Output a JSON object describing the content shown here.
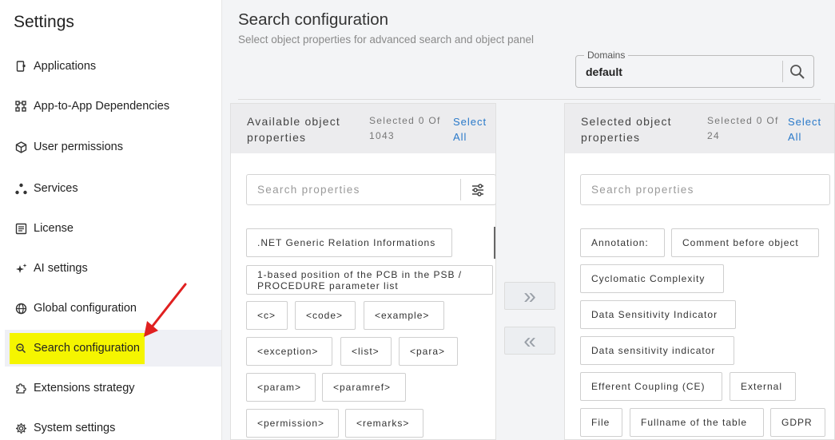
{
  "sidebar": {
    "title": "Settings",
    "items": [
      {
        "label": "Applications",
        "icon": "app-icon"
      },
      {
        "label": "App-to-App Dependencies",
        "icon": "dependencies-icon"
      },
      {
        "label": "User permissions",
        "icon": "cube-icon"
      },
      {
        "label": "Services",
        "icon": "services-icon"
      },
      {
        "label": "License",
        "icon": "license-icon"
      },
      {
        "label": "AI settings",
        "icon": "sparkle-icon"
      },
      {
        "label": "Global configuration",
        "icon": "globe-icon"
      },
      {
        "label": "Search configuration",
        "icon": "search-config-icon",
        "active": true,
        "highlight": "#f5f500"
      },
      {
        "label": "Extensions strategy",
        "icon": "puzzle-icon"
      },
      {
        "label": "System settings",
        "icon": "gear-icon"
      }
    ]
  },
  "main": {
    "title": "Search configuration",
    "subtitle": "Select object properties for advanced search and object panel",
    "domains": {
      "label": "Domains",
      "value": "default"
    }
  },
  "available": {
    "title": "Available object properties",
    "count": "Selected 0 Of 1043",
    "select_all": "Select All",
    "search_placeholder": "Search properties",
    "chips": [
      ".NET Generic Relation Informations",
      "1-based position of the PCB in the PSB / PROCEDURE parameter list",
      "<c>",
      "<code>",
      "<example>",
      "<exception>",
      "<list>",
      "<para>",
      "<param>",
      "<paramref>",
      "<permission>",
      "<remarks>"
    ]
  },
  "selected": {
    "title": "Selected object properties",
    "count": "Selected 0 Of 24",
    "select_all": "Select All",
    "search_placeholder": "Search properties",
    "chips": [
      "Annotation:",
      "Comment before object",
      "Cyclomatic Complexity",
      "Data Sensitivity Indicator",
      "Data sensitivity indicator",
      "Efferent Coupling (CE)",
      "External",
      "File",
      "Fullname of the table",
      "GDPR"
    ]
  },
  "transfer": {
    "add_symbol": "»",
    "remove_symbol": "«"
  },
  "colors": {
    "accent": "#2979c9",
    "highlight": "#f5f500",
    "annotation_arrow": "#e02020"
  }
}
